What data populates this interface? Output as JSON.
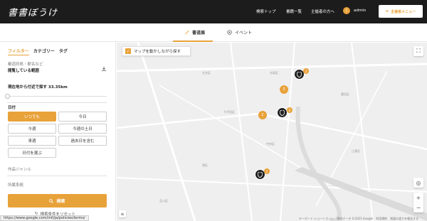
{
  "header": {
    "logo": "書書ぼうけ",
    "nav": [
      "検索トップ",
      "書籍一覧",
      "主催者の方へ"
    ],
    "user": {
      "avatar": "J",
      "name": "admin"
    },
    "host_menu": "主催者メニュー"
  },
  "tabs": [
    {
      "label": "書道展",
      "icon": "brush-icon",
      "active": true
    },
    {
      "label": "イベント",
      "icon": "event-icon",
      "active": false
    }
  ],
  "filter": {
    "tabs": [
      "フィルター",
      "カテゴリー",
      "タグ"
    ],
    "region_label": "都道府県・駅名など",
    "region_value": "閲覧している範囲",
    "radius_label": "現在地から付近で探す 33.35km",
    "date_label": "日付",
    "date_buttons": [
      {
        "label": "いつでも",
        "active": true
      },
      {
        "label": "今日",
        "active": false
      },
      {
        "label": "今週",
        "active": false
      },
      {
        "label": "今週の土日",
        "active": false
      },
      {
        "label": "来週",
        "active": false
      },
      {
        "label": "過去日を含む",
        "active": false
      },
      {
        "label": "日付を選ぶ",
        "active": false
      }
    ],
    "genre_label": "作品ジャンル",
    "system_label": "所属系統",
    "search_button": "検索",
    "reset": "検索条件をリセット"
  },
  "map": {
    "move_search": "マップを動かしながら探す",
    "clusters": [
      "3",
      "2"
    ],
    "badges": [
      "2",
      "6",
      "2"
    ],
    "labels": [
      "台東区",
      "墨田区",
      "江東区",
      "中央区",
      "港区",
      "千代田区",
      "文京区",
      "品川区"
    ],
    "attribution": "キーボード ショートカット　地図データ ©2023 Google　利用規約　地図の誤りを報告する"
  },
  "status_url": "https://www.google.com/intl/ja/policies/terms/",
  "colors": {
    "accent": "#e8a23a",
    "topbar": "#1c1c1c"
  }
}
